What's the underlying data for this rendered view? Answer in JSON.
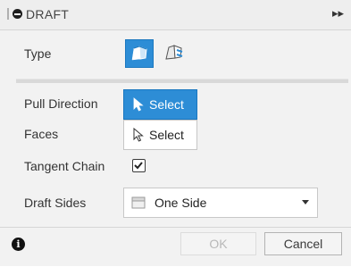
{
  "header": {
    "title": "DRAFT",
    "collapse_glyph": "▸▸"
  },
  "rows": {
    "type": {
      "label": "Type",
      "options": [
        "angle-draft-icon",
        "parting-line-draft-icon"
      ],
      "selected": "angle-draft-icon"
    },
    "pull_direction": {
      "label": "Pull Direction",
      "button_label": "Select"
    },
    "faces": {
      "label": "Faces",
      "button_label": "Select"
    },
    "tangent_chain": {
      "label": "Tangent Chain",
      "checked": true
    },
    "draft_sides": {
      "label": "Draft Sides",
      "value": "One Side"
    }
  },
  "footer": {
    "info_glyph": "i",
    "ok_label": "OK",
    "cancel_label": "Cancel",
    "ok_enabled": false
  },
  "colors": {
    "accent": "#2d8dd6",
    "panel_bg": "#f2f2f2"
  }
}
